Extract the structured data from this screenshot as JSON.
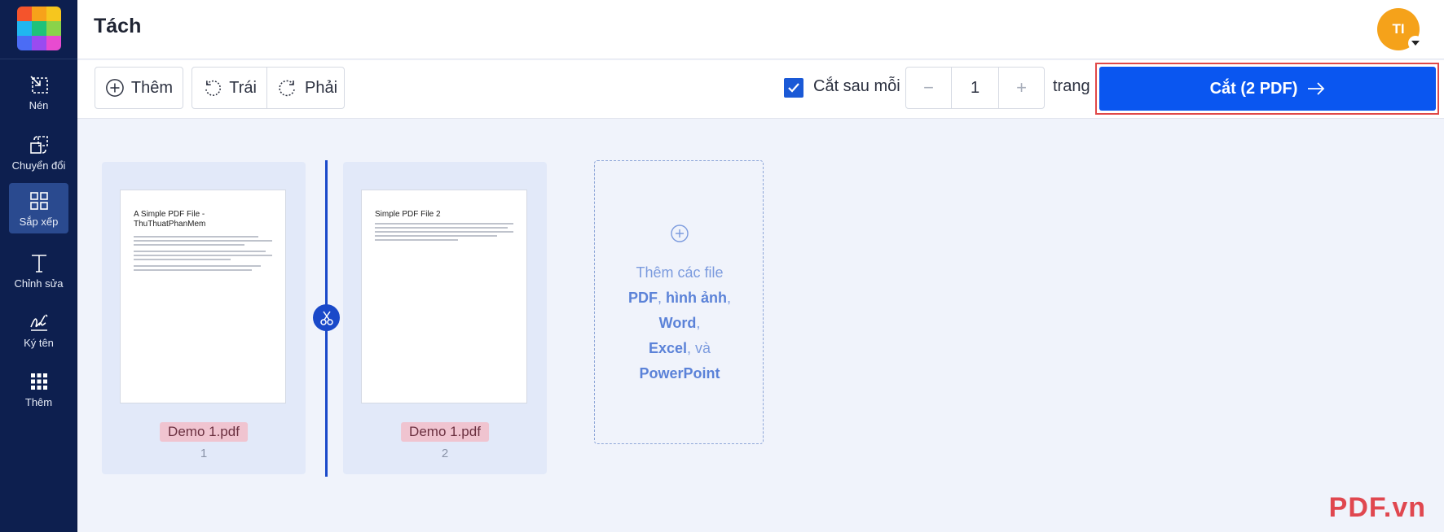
{
  "app": {
    "title": "Tách",
    "avatar_initials": "TI"
  },
  "sidebar": {
    "items": [
      {
        "label": "Nén",
        "icon": "compress-icon"
      },
      {
        "label": "Chuyển đổi",
        "icon": "convert-icon"
      },
      {
        "label": "Sắp xếp",
        "icon": "grid-icon",
        "active": true
      },
      {
        "label": "Chỉnh sửa",
        "icon": "text-edit-icon"
      },
      {
        "label": "Ký tên",
        "icon": "signature-icon"
      },
      {
        "label": "Thêm",
        "icon": "apps-grid-icon"
      }
    ]
  },
  "toolbar": {
    "add_label": "Thêm",
    "rotate_left_label": "Trái",
    "rotate_right_label": "Phải",
    "split_after_label": "Cắt sau mỗi",
    "split_after_checked": true,
    "page_count": "1",
    "pages_unit": "trang",
    "cut_button_label": "Cắt (2 PDF)"
  },
  "pages": [
    {
      "file_name": "Demo 1.pdf",
      "page_number": "1",
      "heading": "A Simple PDF File - ThuThuatPhanMem"
    },
    {
      "file_name": "Demo 1.pdf",
      "page_number": "2",
      "heading": "Simple PDF File 2"
    }
  ],
  "dropzone": {
    "prefix": "Thêm các file",
    "types": [
      "PDF",
      "hình ảnh",
      "Word",
      "Excel"
    ],
    "conjunction": "và",
    "last_type": "PowerPoint"
  },
  "watermark": "PDF.vn",
  "colors": {
    "sidebar": "#0d1f4f",
    "accent": "#0a56f0",
    "avatar": "#f5a21a",
    "highlight": "#e04848"
  }
}
